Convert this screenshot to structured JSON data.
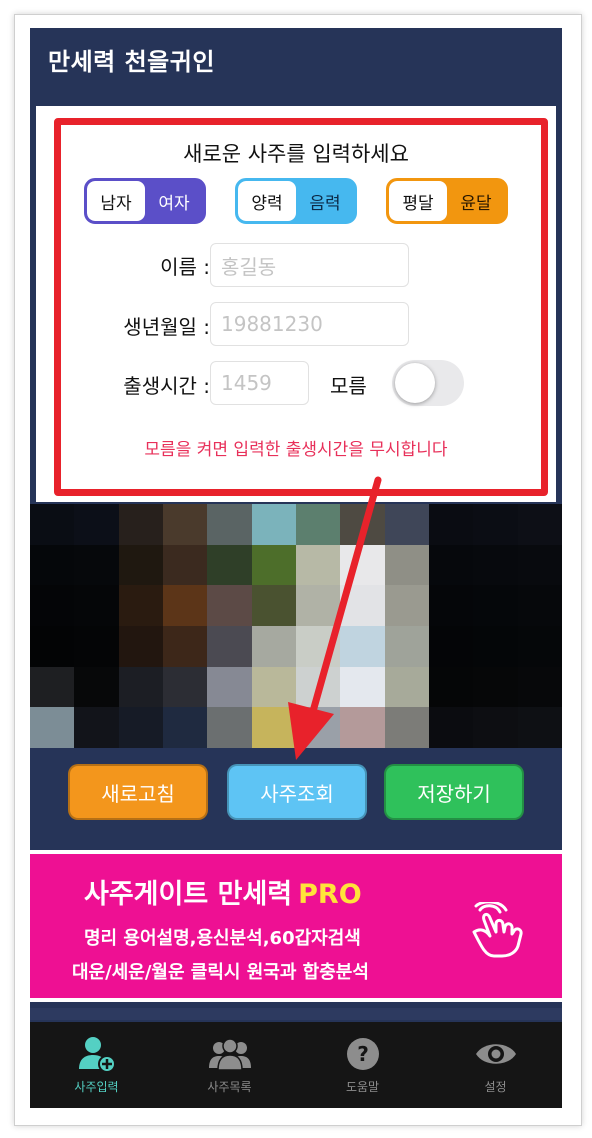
{
  "app": {
    "title": "만세력 천을귀인"
  },
  "form": {
    "title": "새로운 사주를 입력하세요",
    "gender": {
      "male": "남자",
      "female": "여자"
    },
    "calendar": {
      "solar": "양력",
      "lunar": "음력"
    },
    "leap": {
      "normal": "평달",
      "leap": "윤달"
    },
    "name_label": "이름 :",
    "name_placeholder": "홍길동",
    "birth_label": "생년월일 :",
    "birth_placeholder": "19881230",
    "time_label": "출생시간 :",
    "time_placeholder": "1459",
    "unknown_label": "모름",
    "hint": "모름을 켜면 입력한 출생시간을 무시합니다"
  },
  "buttons": {
    "refresh": "새로고침",
    "query": "사주조회",
    "save": "저장하기"
  },
  "banner": {
    "title": "사주게이트 만세력",
    "pro": "PRO",
    "line1": "명리 용어설명,용신분석,60갑자검색",
    "line2": "대운/세운/월운 클릭시 원국과 합충분석"
  },
  "tabs": {
    "input": "사주입력",
    "list": "사주목록",
    "help": "도움말",
    "settings": "설정"
  },
  "colors": {
    "header_bg": "#263458",
    "highlight_red": "#e8222b",
    "gender_accent": "#5b4fc8",
    "calendar_accent": "#46b8ef",
    "leap_accent": "#f2960f",
    "banner_bg": "#ee1093",
    "active_tab": "#54d0c3"
  }
}
